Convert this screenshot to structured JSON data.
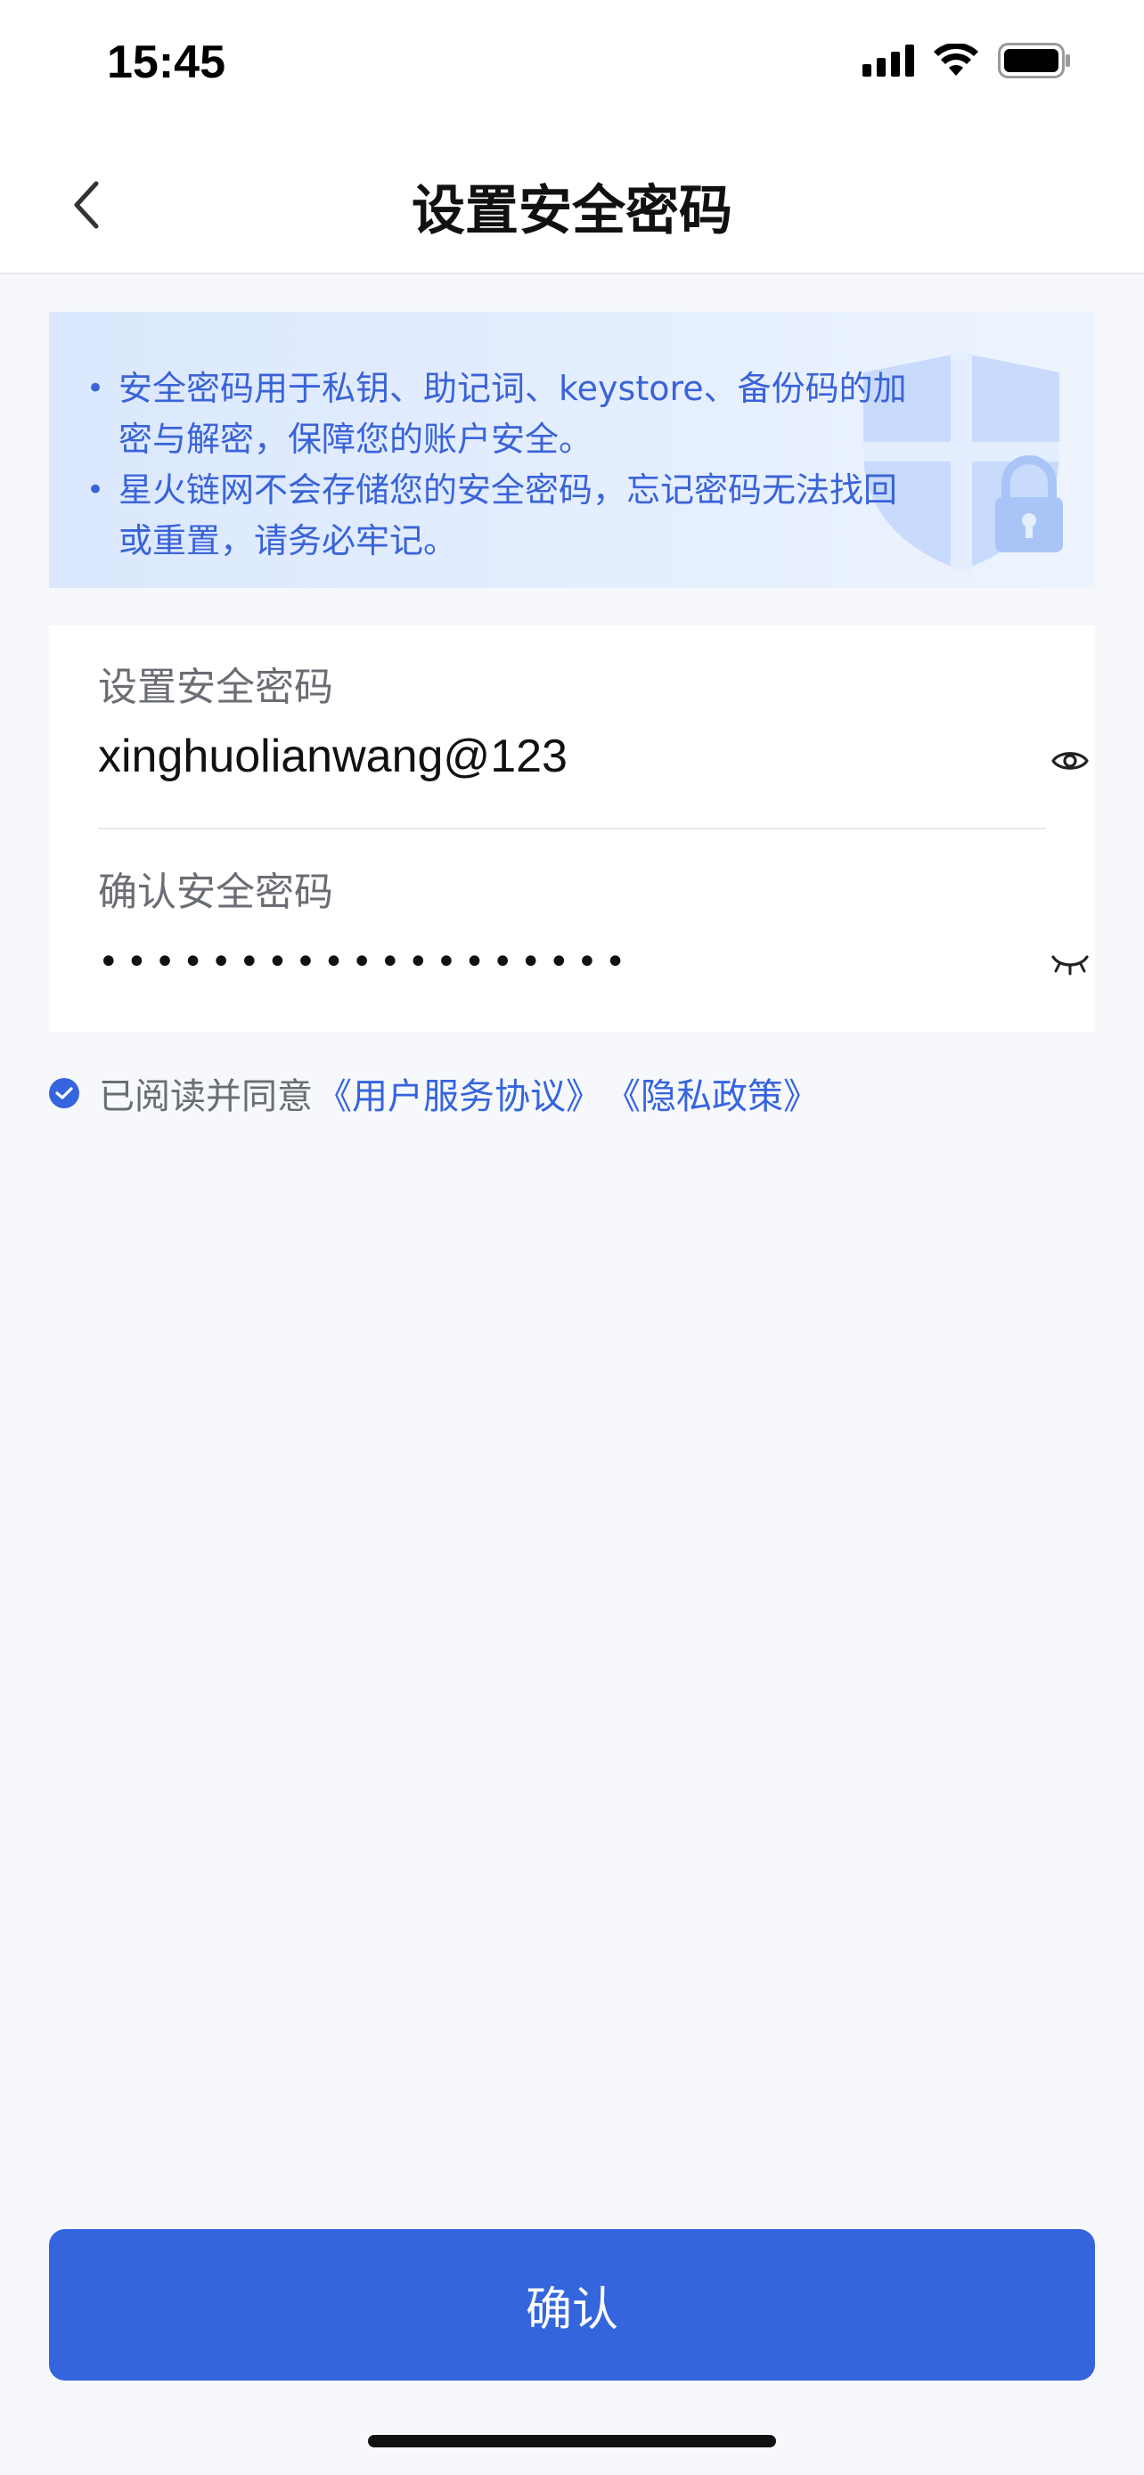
{
  "status_bar": {
    "time": "15:45",
    "icons": [
      "signal-icon",
      "wifi-icon",
      "battery-icon"
    ]
  },
  "header": {
    "title": "设置安全密码",
    "back_icon": "chevron-left-icon"
  },
  "notice": {
    "items": [
      "安全密码用于私钥、助记词、keystore、备份码的加密与解密，保障您的账户安全。",
      "星火链网不会存储您的安全密码，忘记密码无法找回或重置，请务必牢记。"
    ],
    "illustration": "shield-lock-icon"
  },
  "form": {
    "password": {
      "label": "设置安全密码",
      "value": "xinghuolianwang@123",
      "toggle_icon": "eye-open-icon"
    },
    "confirm": {
      "label": "确认安全密码",
      "value": "•••••••••••••••••••",
      "toggle_icon": "eye-closed-icon"
    }
  },
  "agreement": {
    "checked": true,
    "prefix": "已阅读并同意",
    "terms_link": "《用户服务协议》",
    "privacy_link": "《隐私政策》"
  },
  "confirm_button": {
    "label": "确认"
  },
  "colors": {
    "primary": "#3465dd",
    "notice_text": "#3a63d8",
    "background": "#f6f8fb"
  }
}
